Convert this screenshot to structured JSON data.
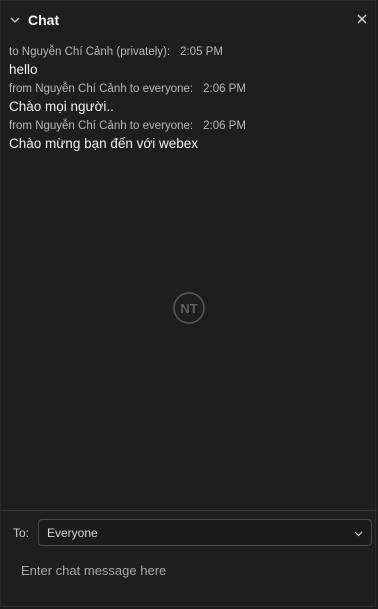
{
  "header": {
    "title": "Chat",
    "collapse_icon": "chevron-down-icon",
    "close_icon": "close-icon"
  },
  "messages": [
    {
      "meta": "to Nguyễn Chí Cảnh (privately):",
      "time": "2:05 PM",
      "text": "hello"
    },
    {
      "meta": "from Nguyễn Chí Cảnh to everyone:",
      "time": "2:06 PM",
      "text": "Chào mọi người.."
    },
    {
      "meta": "from Nguyễn Chí Cảnh to everyone:",
      "time": "2:06 PM",
      "text": "Chào mừng bạn đến với webex"
    }
  ],
  "watermark": {
    "text": "NT"
  },
  "compose": {
    "to_label": "To:",
    "recipient": "Everyone",
    "recipient_icon": "chevron-down-icon",
    "placeholder": "Enter chat message here"
  },
  "colors": {
    "background": "#1e1e1e",
    "text": "#f0f0f0",
    "meta": "#b9b9b9"
  }
}
